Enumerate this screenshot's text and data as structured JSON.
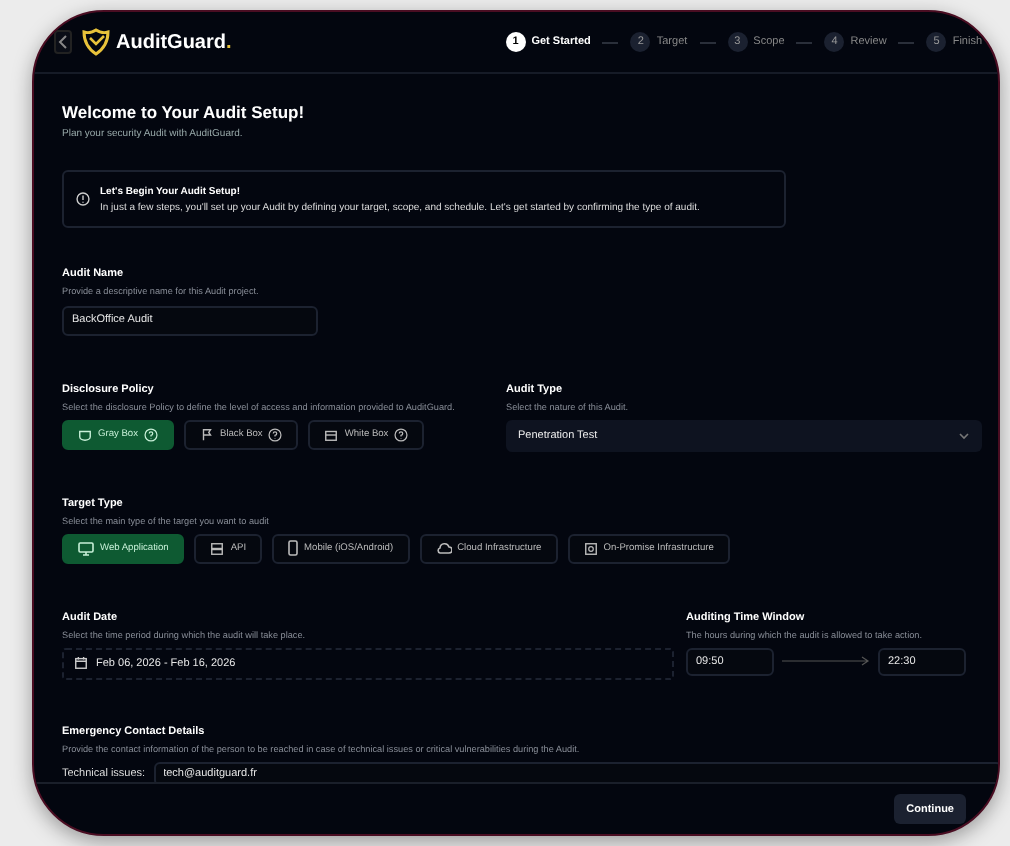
{
  "header": {
    "brand": "AuditGuard",
    "brand_dot": ".",
    "steps": [
      {
        "number": "1",
        "label": "Get Started",
        "selected": true
      },
      {
        "number": "2",
        "label": "Target",
        "selected": false
      },
      {
        "number": "3",
        "label": "Scope",
        "selected": false
      },
      {
        "number": "4",
        "label": "Review",
        "selected": false
      },
      {
        "number": "5",
        "label": "Finish",
        "selected": false
      }
    ]
  },
  "intro": {
    "title": "Welcome to Your Audit Setup!",
    "subtitle": "Plan your security Audit with AuditGuard."
  },
  "notice": {
    "title": "Let's Begin Your Audit Setup!",
    "text": "In just a few steps, you'll set up your Audit by defining your target, scope, and schedule. Let's get started by confirming the type of audit."
  },
  "audit_name": {
    "label": "Audit Name",
    "description": "Provide a descriptive name for this Audit project.",
    "value": "BackOffice Audit"
  },
  "disclosure_policy": {
    "label": "Disclosure Policy",
    "description": "Select the disclosure Policy to define the level of access and information provided to AuditGuard.",
    "options": [
      {
        "label": "Gray Box",
        "selected": true
      },
      {
        "label": "Black Box",
        "selected": false
      },
      {
        "label": "White Box",
        "selected": false
      }
    ]
  },
  "audit_type": {
    "label": "Audit Type",
    "description": "Select the nature of this Audit.",
    "value": "Penetration Test"
  },
  "target_type": {
    "label": "Target Type",
    "description": "Select the main type of the target you want to audit",
    "options": [
      {
        "label": "Web Application",
        "selected": true
      },
      {
        "label": "API",
        "selected": false
      },
      {
        "label": "Mobile (iOS/Android)",
        "selected": false
      },
      {
        "label": "Cloud Infrastructure",
        "selected": false
      },
      {
        "label": "On-Promise Infrastructure",
        "selected": false
      }
    ]
  },
  "audit_date": {
    "label": "Audit Date",
    "description": "Select the time period during which the audit will take place.",
    "value": "Feb 06, 2026 - Feb 16, 2026"
  },
  "time_window": {
    "label": "Auditing Time Window",
    "description": "The hours during which the audit is allowed to take action.",
    "start": "09:50",
    "end": "22:30"
  },
  "emergency_contact": {
    "label": "Emergency Contact Details",
    "description": "Provide the contact information of the person to be reached in case of technical issues or critical vulnerabilities during the Audit.",
    "rows": [
      {
        "label": "Technical issues:",
        "value": "tech@auditguard.fr"
      }
    ]
  },
  "footer": {
    "continue": "Continue"
  }
}
